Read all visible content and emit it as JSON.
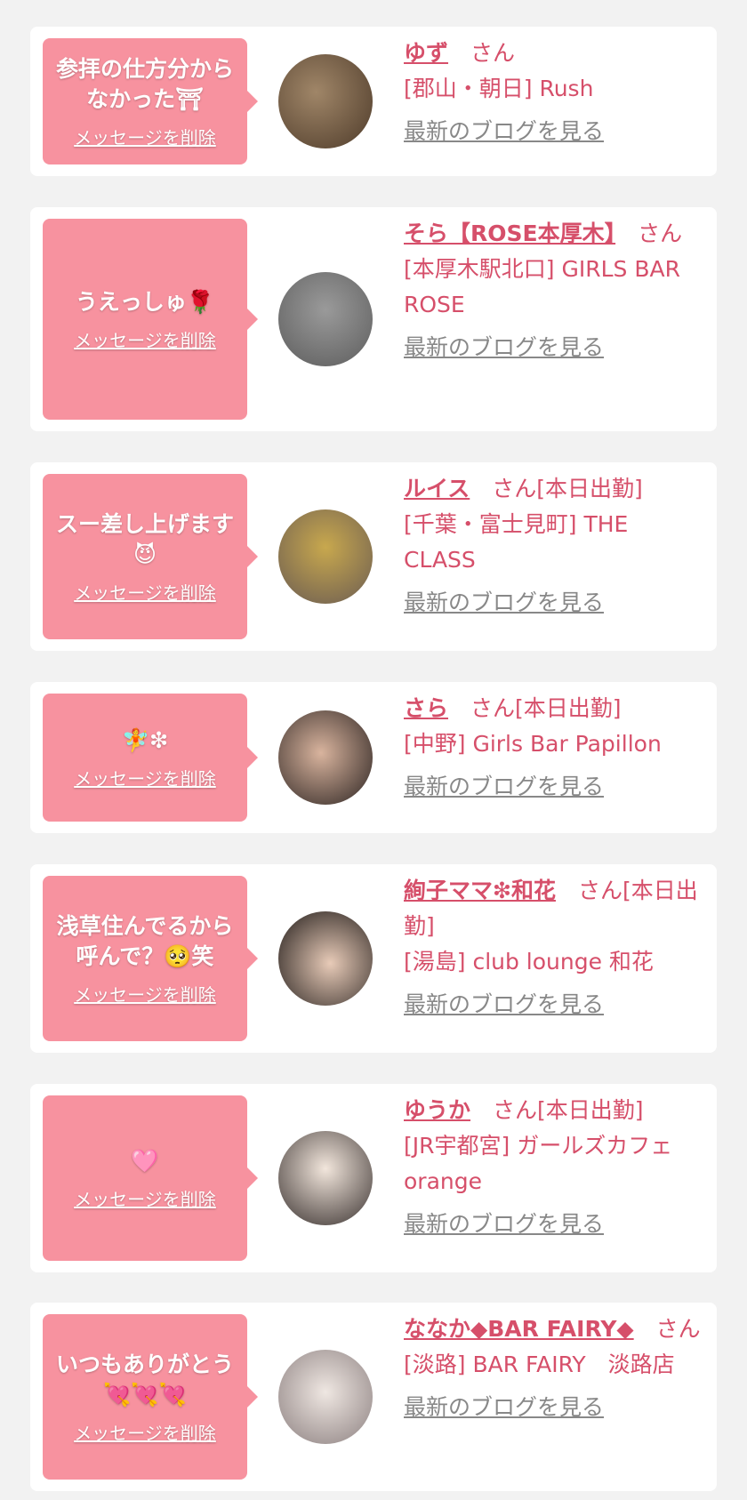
{
  "delete_label": "メッセージを削除",
  "blog_label": "最新のブログを見る",
  "honorific": "さん",
  "cards": [
    {
      "message": "参拝の仕方分から\nなかった⛩",
      "name": "ゆず",
      "status": "",
      "shop": "[郡山・朝日] Rush"
    },
    {
      "message": "うえっしゅ🌹",
      "name": "そら【ROSE本厚木】",
      "status": "",
      "shop": "[本厚木駅北口] GIRLS BAR ROSE"
    },
    {
      "message": "スー差し上げます\n😈",
      "name": "ルイス",
      "status": "[本日出勤]",
      "shop": "[千葉・富士見町] THE CLASS"
    },
    {
      "message": "🧚❇",
      "name": "さら",
      "status": "[本日出勤]",
      "shop": "[中野] Girls Bar Papillon"
    },
    {
      "message": "浅草住んでるから\n呼んで？🥺笑",
      "name": "絢子ママ❇和花",
      "status": "[本日出勤]",
      "shop": "[湯島] club lounge 和花"
    },
    {
      "message": "🩷",
      "name": "ゆうか",
      "status": "[本日出勤]",
      "shop": "[JR宇都宮] ガールズカフェorange"
    },
    {
      "message": "いつもありがとう\n💘💘💘",
      "name": "ななか◆BAR FAIRY◆",
      "status": "",
      "shop": "[淡路] BAR FAIRY　淡路店"
    }
  ],
  "avatar_colors": [
    "#6b5a45",
    "#7a7a7a",
    "#8f7e6e",
    "#4a3a35",
    "#3a302c",
    "#d9cfc7",
    "#cfc8c8"
  ]
}
